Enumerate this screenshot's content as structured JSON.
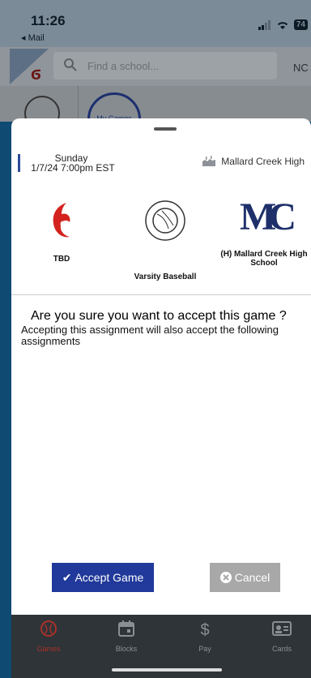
{
  "status": {
    "time": "11:26",
    "back_app": "◂ Mail",
    "battery": "74"
  },
  "header": {
    "search_placeholder": "Find a school...",
    "state": "NC"
  },
  "filters": {
    "my_games": "My Games"
  },
  "game": {
    "day": "Sunday",
    "datetime": "1/7/24 7:00pm EST",
    "venue": "Mallard Creek High",
    "away_team": "TBD",
    "sport": "Varsity Baseball",
    "home_team": "(H) Mallard Creek High School",
    "home_logo_text": "MC"
  },
  "confirm": {
    "title": "Are you sure you want to accept this game ?",
    "body": "Accepting this assignment will also accept the following assignments"
  },
  "buttons": {
    "accept": "Accept Game",
    "cancel": "Cancel"
  },
  "tabs": [
    {
      "label": "Games",
      "icon": "baseball-icon",
      "active": true
    },
    {
      "label": "Blocks",
      "icon": "calendar-icon"
    },
    {
      "label": "Pay",
      "icon": "dollar-icon"
    },
    {
      "label": "Cards",
      "icon": "id-card-icon"
    }
  ],
  "colors": {
    "accent": "#20399a",
    "brand_red": "#d4231f",
    "cancel_gray": "#a8a8a8",
    "tabbar": "#2f3438"
  }
}
